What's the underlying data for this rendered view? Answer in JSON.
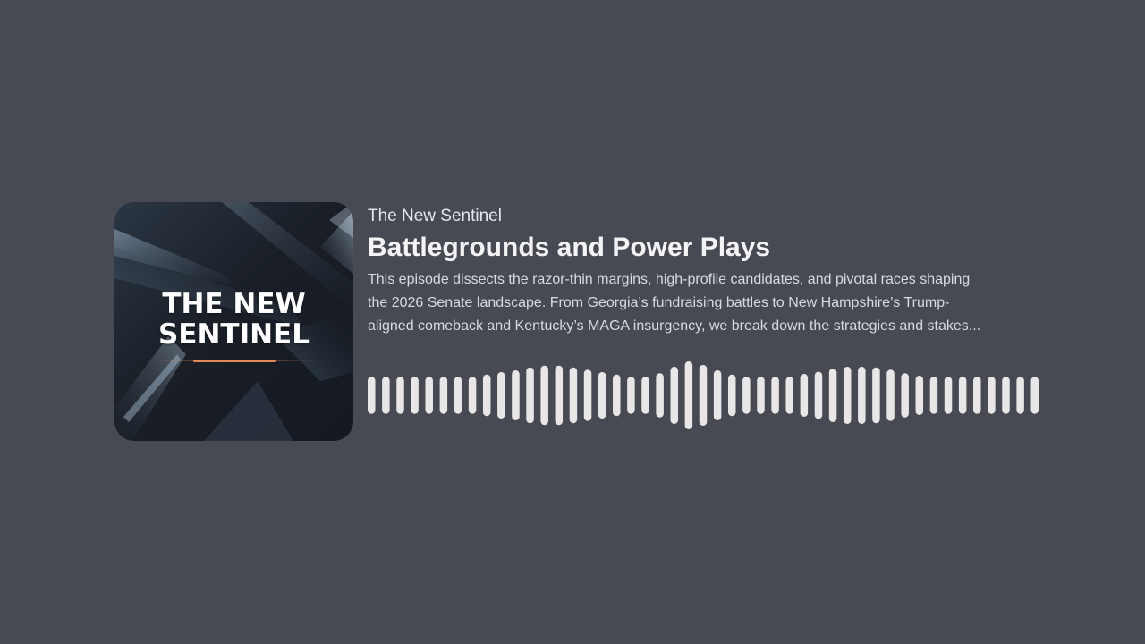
{
  "cover": {
    "title_line1": "THE NEW",
    "title_line2": "SENTINEL",
    "accent_color": "#e0895a"
  },
  "show_name": "The New Sentinel",
  "episode_title": "Battlegrounds and Power Plays",
  "description_lines": [
    "This episode dissects the razor-thin margins, high-profile candidates, and pivotal races shaping",
    "the 2026 Senate landscape. From Georgia’s fundraising battles to New Hampshire’s Trump-",
    "aligned comeback and Kentucky’s MAGA insurgency, we break down the strategies and stakes..."
  ],
  "waveform": {
    "color": "#e8e6e6",
    "levels": [
      0.52,
      0.52,
      0.52,
      0.52,
      0.52,
      0.52,
      0.52,
      0.52,
      0.58,
      0.65,
      0.7,
      0.78,
      0.83,
      0.83,
      0.78,
      0.72,
      0.65,
      0.58,
      0.52,
      0.52,
      0.62,
      0.8,
      0.95,
      0.85,
      0.7,
      0.58,
      0.52,
      0.52,
      0.52,
      0.52,
      0.6,
      0.66,
      0.75,
      0.8,
      0.8,
      0.78,
      0.72,
      0.62,
      0.55,
      0.52,
      0.52,
      0.52,
      0.52,
      0.52,
      0.52,
      0.52,
      0.52
    ]
  }
}
